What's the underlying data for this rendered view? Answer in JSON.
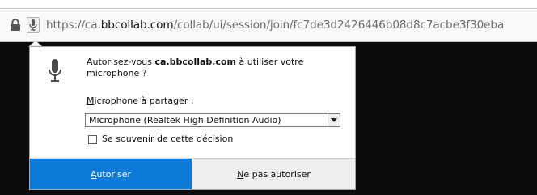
{
  "url_bar": {
    "url_prefix": "https://ca.",
    "url_domain": "bbcollab.com",
    "url_path": "/collab/ui/session/join/fc7de3d2426446b08d8c7acbe3f30eba",
    "lock_icon": "lock-icon",
    "mic_icon": "microphone-icon"
  },
  "dialog": {
    "question_prefix": "Autorisez-vous ",
    "question_site": "ca.bbcollab.com",
    "question_suffix": " à utiliser votre microphone ?",
    "share_label": "Microphone à partager :",
    "device_selected": "Microphone (Realtek High Definition Audio)",
    "remember_label": "Se souvenir de cette décision",
    "remember_checked": false,
    "allow_label": "Autoriser",
    "deny_label": "Ne pas autoriser"
  },
  "colors": {
    "accent": "#0e7ad9",
    "page_background": "#0c0c0c"
  }
}
